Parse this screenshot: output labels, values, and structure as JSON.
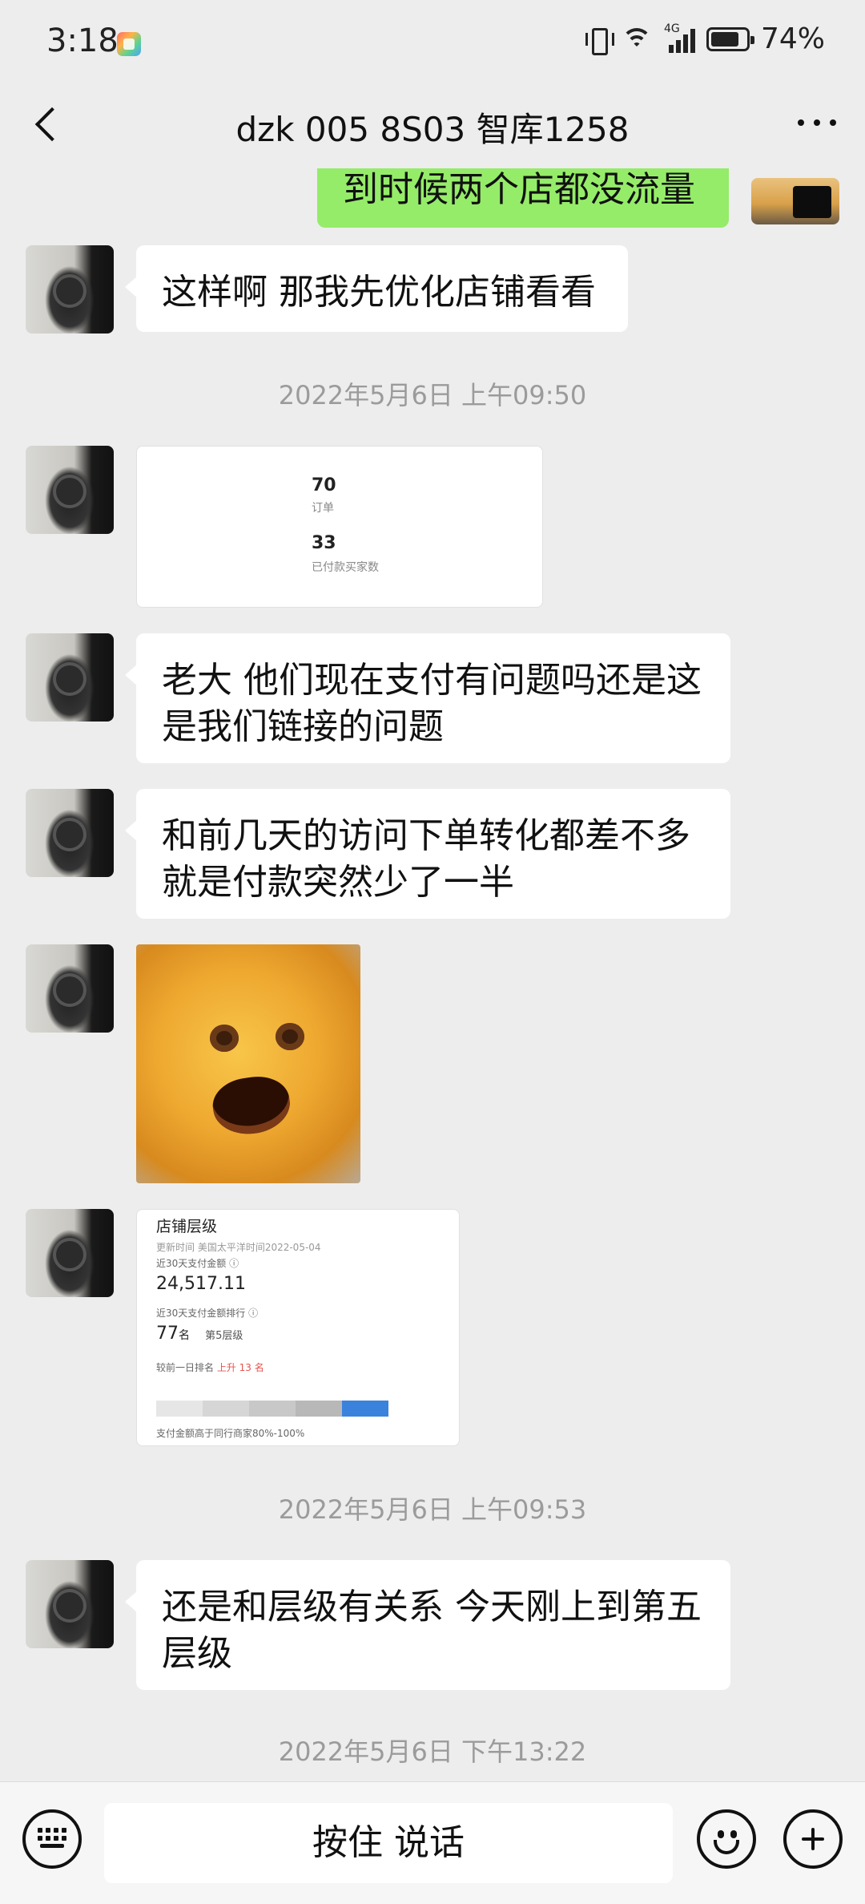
{
  "status_bar": {
    "time": "3:18",
    "network": "4G",
    "battery": "74%"
  },
  "chat": {
    "title": "dzk 005 8S03 智库1258"
  },
  "messages": {
    "cut_off_text": "到时候两个店都没流量",
    "m1": "这样啊 那我先优化店铺看看",
    "ts1": "2022年5月6日 上午09:50",
    "stats_image": {
      "orders_value": "70",
      "orders_label": "订单",
      "buyers_value": "33",
      "buyers_label": "已付款买家数"
    },
    "m2": "老大 他们现在支付有问题吗还是这是我们链接的问题",
    "m3": "和前几天的访问下单转化都差不多就是付款突然少了一半",
    "shop_image": {
      "title": "店铺层级",
      "update_time": "更新时间 美国太平洋时间2022-05-04",
      "amount_label": "近30天支付金额 ⓘ",
      "amount": "24,517.11",
      "rank_label": "近30天支付金额排行 ⓘ",
      "rank": "77",
      "rank_unit": "名",
      "level": "第5层级",
      "change_prefix": "较前一日排名",
      "change": "上升 13 名",
      "footer": "支付金额高于同行商家80%-100%",
      "level_segments": 5,
      "active_segment": 5
    },
    "ts2": "2022年5月6日 上午09:53",
    "m4": "还是和层级有关系 今天刚上到第五层级",
    "ts3": "2022年5月6日 下午13:22"
  },
  "input_bar": {
    "hold_to_talk": "按住 说话"
  },
  "colors": {
    "my_bubble": "#95ec69",
    "background": "#ededed",
    "rank_up": "#e8534f",
    "level_active": "#3b82dc"
  }
}
